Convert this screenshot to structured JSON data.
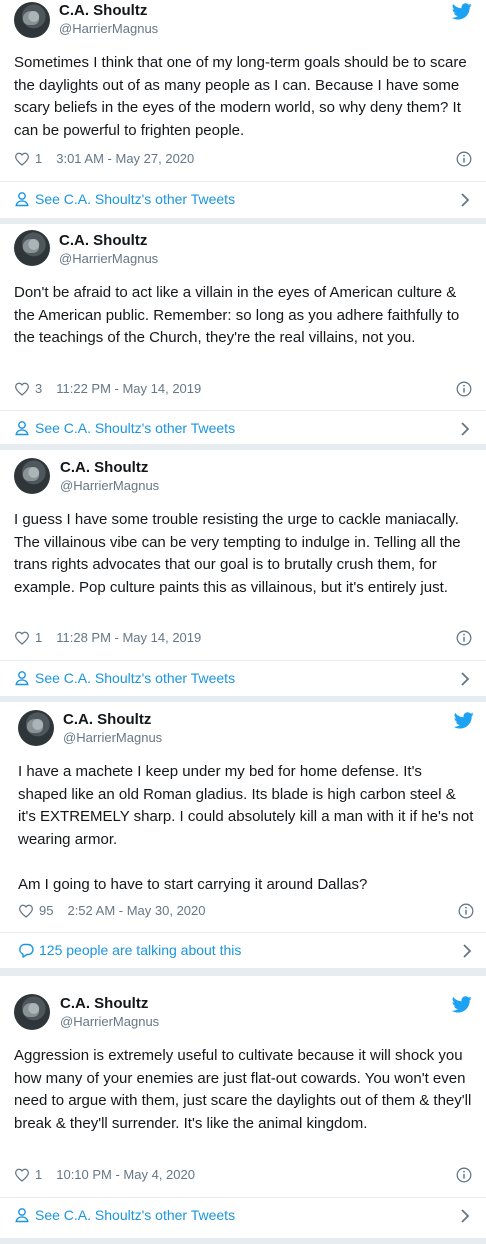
{
  "tweets": [
    {
      "name": "C.A. Shoultz",
      "handle": "@HarrierMagnus",
      "text": "Sometimes I think that one of my long-term goals should be to scare the daylights out of as many people as I can.  Because I have some scary beliefs in the eyes of the modern world, so why deny them?  It can be powerful to frighten people.",
      "likes": "1",
      "timestamp": "3:01 AM - May 27, 2020",
      "footer": "See C.A. Shoultz's other Tweets"
    },
    {
      "name": "C.A. Shoultz",
      "handle": "@HarrierMagnus",
      "text": "Don't be afraid to act like a villain in the eyes of American culture & the American public. Remember: so long as you adhere faithfully to the teachings of the Church, they're the real villains, not you.",
      "likes": "3",
      "timestamp": "11:22 PM - May 14, 2019",
      "footer": "See C.A. Shoultz's other Tweets"
    },
    {
      "name": "C.A. Shoultz",
      "handle": "@HarrierMagnus",
      "text": "I guess I have some trouble resisting the urge to cackle maniacally. The villainous vibe can be very tempting to indulge in. Telling all the trans rights advocates that our goal is to brutally crush them, for example. Pop culture paints this as villainous, but it's entirely just.",
      "likes": "1",
      "timestamp": "11:28 PM - May 14, 2019",
      "footer": "See C.A. Shoultz's other Tweets"
    },
    {
      "name": "C.A. Shoultz",
      "handle": "@HarrierMagnus",
      "text": "I have a machete I keep under my bed for home defense.  It's shaped like an old Roman gladius.  Its blade is high carbon steel & it's EXTREMELY sharp. I could absolutely kill a man with it if he's not wearing armor.\n\nAm I going to have to start carrying it around Dallas?",
      "likes": "95",
      "timestamp": "2:52 AM - May 30, 2020",
      "footer": "125 people are talking about this"
    },
    {
      "name": "C.A. Shoultz",
      "handle": "@HarrierMagnus",
      "text": "Aggression is extremely useful to cultivate because it will shock you how many of your enemies are just flat-out cowards.  You won't even need to argue with them, just scare the daylights out of them & they'll break & they'll surrender.  It's like the animal kingdom.",
      "likes": "1",
      "timestamp": "10:10 PM - May 4, 2020",
      "footer": "See C.A. Shoultz's other Tweets"
    }
  ],
  "colors": {
    "accent": "#1b95e0",
    "twitter_blue": "#1da1f2",
    "secondary_text": "#657786",
    "separator": "#e6ecf0"
  }
}
